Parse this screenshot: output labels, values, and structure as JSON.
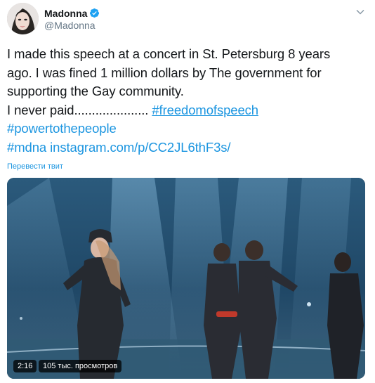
{
  "author": {
    "display_name": "Madonna",
    "handle": "@Madonna"
  },
  "tweet": {
    "line1": "I made this speech at a concert in St. Petersburg 8 years",
    "line2": "ago. I was fined 1 million dollars by The government for",
    "line3": "supporting the Gay community.",
    "line4_text": "I never paid..................... ",
    "hashtag_freedom": "#freedomofspeech",
    "hashtag_power": "#powertothepeople",
    "hashtag_mdna": "#mdna",
    "link": "instagram.com/p/CC2JL6thF3s/"
  },
  "translate_label": "Перевести твит",
  "video": {
    "duration": "2:16",
    "views": "105 тыс. просмотров"
  },
  "colors": {
    "link": "#1b95e0",
    "verified": "#1da1f2"
  },
  "icons": {
    "verified": "verified-badge-icon",
    "menu": "chevron-down-icon"
  }
}
